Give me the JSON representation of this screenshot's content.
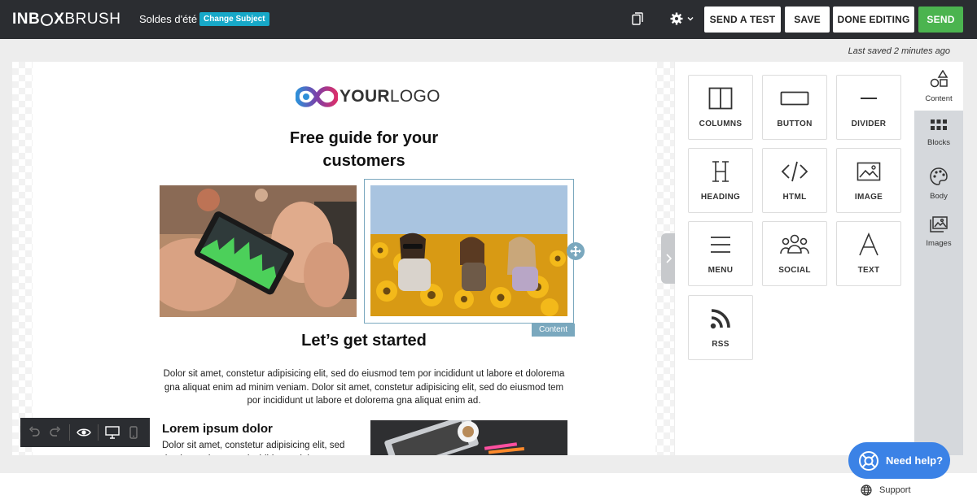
{
  "app": {
    "logo_bold_left": "INB",
    "logo_bold_right": "X",
    "logo_light": "BRUSH"
  },
  "header": {
    "subject": "Soldes d'été",
    "change_subject_label": "Change Subject",
    "send_test_label": "SEND A TEST",
    "save_label": "SAVE",
    "done_editing_label": "DONE EDITING",
    "send_label": "SEND"
  },
  "status": {
    "last_saved": "Last saved 2 minutes ago"
  },
  "email": {
    "logo_text_bold": "YOUR",
    "logo_text_light": "LOGO",
    "hero_title": "Free guide for your customers",
    "selection_label": "Content",
    "section_title": "Let’s get started",
    "section_body": "Dolor sit amet, constetur adipisicing elit, sed do eiusmod tem por incididunt ut labore et dolorema gna aliquat enim ad minim veniam. Dolor sit amet, constetur adipisicing elit, sed do eiusmod tem por incididunt ut labore et dolorema gna aliquat enim ad.",
    "sub_title": "Lorem ipsum dolor",
    "sub_body": "Dolor sit amet, constetur adipisicing elit, sed do eiusmod tem por incididunt ut labore"
  },
  "content_tiles": [
    {
      "label": "COLUMNS",
      "icon": "columns-icon"
    },
    {
      "label": "BUTTON",
      "icon": "button-icon"
    },
    {
      "label": "DIVIDER",
      "icon": "divider-icon"
    },
    {
      "label": "HEADING",
      "icon": "heading-icon"
    },
    {
      "label": "HTML",
      "icon": "code-icon"
    },
    {
      "label": "IMAGE",
      "icon": "image-icon"
    },
    {
      "label": "MENU",
      "icon": "menu-icon"
    },
    {
      "label": "SOCIAL",
      "icon": "social-icon"
    },
    {
      "label": "TEXT",
      "icon": "text-icon"
    },
    {
      "label": "RSS",
      "icon": "rss-icon"
    }
  ],
  "side_tabs": [
    {
      "label": "Content",
      "icon": "shapes-icon"
    },
    {
      "label": "Blocks",
      "icon": "grid-icon"
    },
    {
      "label": "Body",
      "icon": "palette-icon"
    },
    {
      "label": "Images",
      "icon": "images-icon"
    }
  ],
  "help": {
    "need_help_label": "Need help?",
    "support_label": "Support"
  },
  "colors": {
    "accent": "#17a8c8",
    "send": "#4bb44f",
    "selection": "#7aa8be",
    "help": "#3b82e6",
    "topbar": "#2b2d31"
  }
}
